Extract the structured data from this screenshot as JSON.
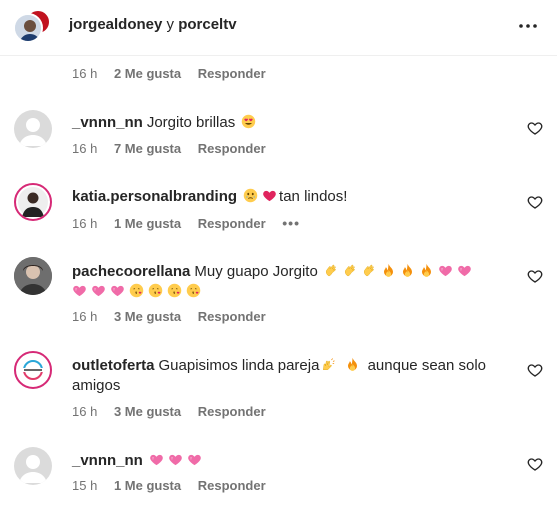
{
  "header": {
    "user1": "jorgealdoney",
    "separator": "y",
    "user2": "porceltv"
  },
  "top_meta": {
    "time": "16 h",
    "likes": "2 Me gusta",
    "reply": "Responder"
  },
  "comments": [
    {
      "username": "_vnnn_nn",
      "text": "Jorgito brillas",
      "time": "16 h",
      "likes": "7 Me gusta",
      "reply": "Responder"
    },
    {
      "username": "katia.personalbranding",
      "text": "tan lindos!",
      "time": "16 h",
      "likes": "1 Me gusta",
      "reply": "Responder",
      "more": "•••"
    },
    {
      "username": "pachecoorellana",
      "text": "Muy guapo Jorgito",
      "time": "16 h",
      "likes": "3 Me gusta",
      "reply": "Responder"
    },
    {
      "username": "outletoferta",
      "text_a": "Guapisimos linda pareja",
      "text_b": "aunque sean solo amigos",
      "time": "16 h",
      "likes": "3 Me gusta",
      "reply": "Responder"
    },
    {
      "username": "_vnnn_nn",
      "text": "",
      "time": "15 h",
      "likes": "1 Me gusta",
      "reply": "Responder"
    }
  ],
  "icons": {
    "more": "more-horizontal-icon",
    "like": "heart-outline-icon",
    "default_avatar": "default-user-avatar-icon"
  },
  "colors": {
    "text": "#262626",
    "meta": "#737373",
    "divider": "#efefef"
  }
}
